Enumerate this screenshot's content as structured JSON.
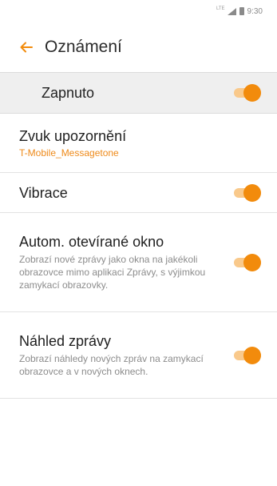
{
  "status_bar": {
    "network": "LTE",
    "time": "9:30",
    "icons": [
      "signal-icon",
      "battery-icon"
    ]
  },
  "header": {
    "title": "Oznámení",
    "back_icon": "arrow-left-icon",
    "accent_color": "#f28b0c"
  },
  "master_toggle": {
    "label": "Zapnuto",
    "on": true
  },
  "settings": {
    "sound": {
      "title": "Zvuk upozornění",
      "value": "T-Mobile_Messagetone"
    },
    "vibration": {
      "title": "Vibrace",
      "on": true
    },
    "auto_window": {
      "title": "Autom. otevírané okno",
      "description": "Zobrazí nové zprávy jako okna na jakékoli obrazovce mimo aplikaci Zprávy, s výjimkou zamykací obrazovky.",
      "on": true
    },
    "preview": {
      "title": "Náhled zprávy",
      "description": "Zobrazí náhledy nových zpráv na zamykací obrazovce a v nových oknech.",
      "on": true
    }
  },
  "colors": {
    "toggle_on_knob": "#f28b0c",
    "toggle_on_track": "#f9c98b",
    "subtitle_accent": "#ee8a1a",
    "master_row_bg": "#efefef"
  }
}
